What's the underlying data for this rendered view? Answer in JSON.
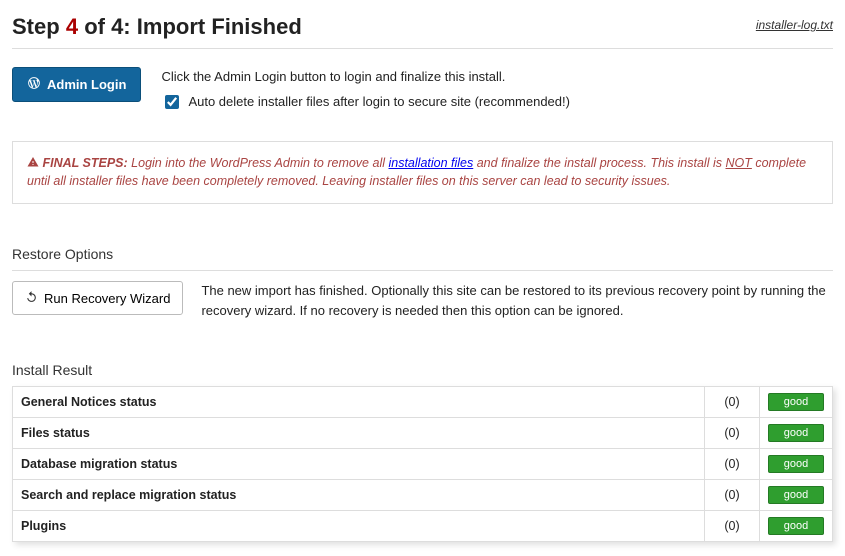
{
  "header": {
    "prefix": "Step",
    "current": "4",
    "of_label": "of 4:",
    "title": "Import Finished",
    "log_link": "installer-log.txt"
  },
  "login": {
    "button": "Admin Login",
    "instruction": "Click the Admin Login button to login and finalize this install.",
    "checkbox_checked": true,
    "checkbox_label": "Auto delete installer files after login to secure site (recommended!)"
  },
  "warning": {
    "title": "FINAL STEPS:",
    "part1": "Login into the WordPress Admin to remove all",
    "link1": "installation files",
    "part2": "and finalize the install process. This install is",
    "not": "NOT",
    "part3": "complete until all installer files have been completely removed. Leaving installer files on this server can lead to security issues."
  },
  "restore": {
    "heading": "Restore Options",
    "button": "Run Recovery Wizard",
    "text": "The new import has finished. Optionally this site can be restored to its previous recovery point by running the recovery wizard. If no recovery is needed then this option can be ignored."
  },
  "results": {
    "heading": "Install Result",
    "rows": [
      {
        "label": "General Notices status",
        "count": "(0)",
        "badge": "good"
      },
      {
        "label": "Files status",
        "count": "(0)",
        "badge": "good"
      },
      {
        "label": "Database migration status",
        "count": "(0)",
        "badge": "good"
      },
      {
        "label": "Search and replace migration status",
        "count": "(0)",
        "badge": "good"
      },
      {
        "label": "Plugins",
        "count": "(0)",
        "badge": "good"
      }
    ]
  }
}
